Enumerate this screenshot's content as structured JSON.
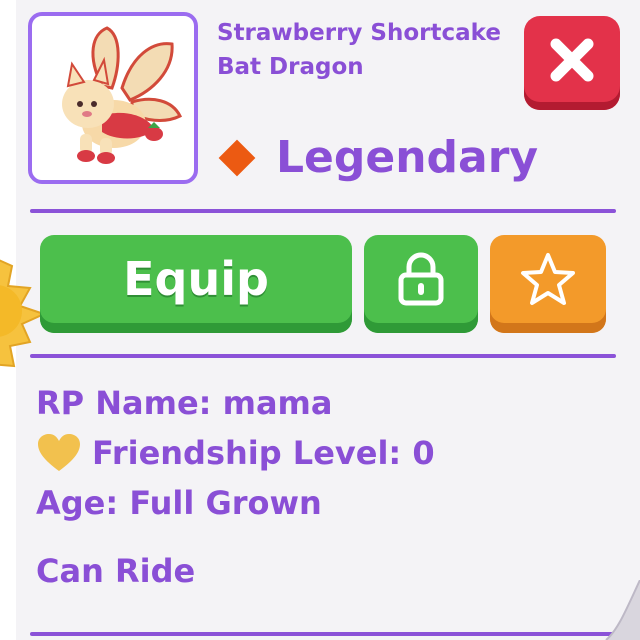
{
  "pet": {
    "name": "Strawberry Shortcake Bat Dragon",
    "rarity": "Legendary",
    "rarity_color": "#ec5a12",
    "image_icon": "strawberry-shortcake-bat-dragon-pet-icon"
  },
  "actions": {
    "equip_label": "Equip",
    "lock_icon": "lock-icon",
    "favorite_icon": "star-icon",
    "close_icon": "close-icon"
  },
  "info": {
    "rp_name": "RP Name: mama",
    "friendship": "Friendship Level: 0",
    "age": "Age: Full Grown",
    "ride": "Can Ride"
  },
  "colors": {
    "text": "#8a4fd6",
    "divider": "#8b52d8",
    "green_button": "#4cbf4c",
    "orange_button": "#f39a2a",
    "close_button": "#e3324a",
    "heart": "#f2c14e"
  }
}
